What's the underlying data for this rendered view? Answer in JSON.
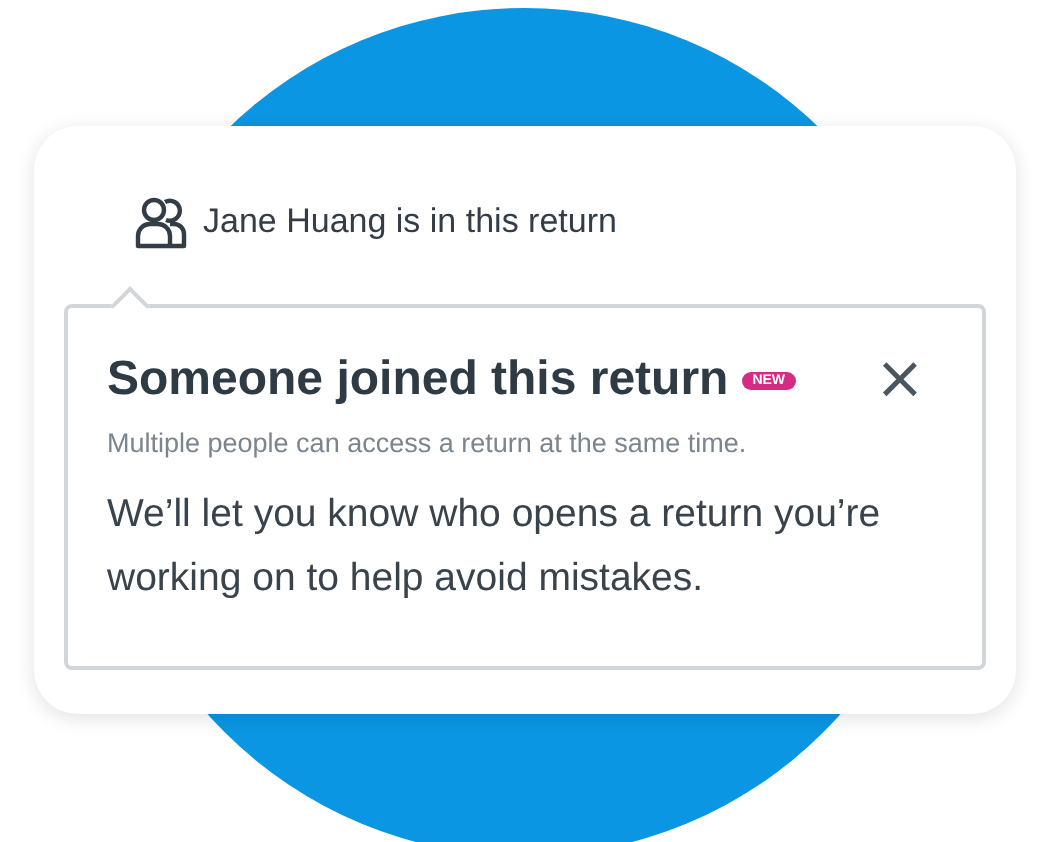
{
  "presence": {
    "text": "Jane Huang is in this return"
  },
  "popover": {
    "title": "Someone joined this return",
    "badge": "NEW",
    "close": "×",
    "subtitle": "Multiple people can access a return at the same time.",
    "body": "We’ll let you know who opens a return you’re working on to help avoid mistakes."
  }
}
